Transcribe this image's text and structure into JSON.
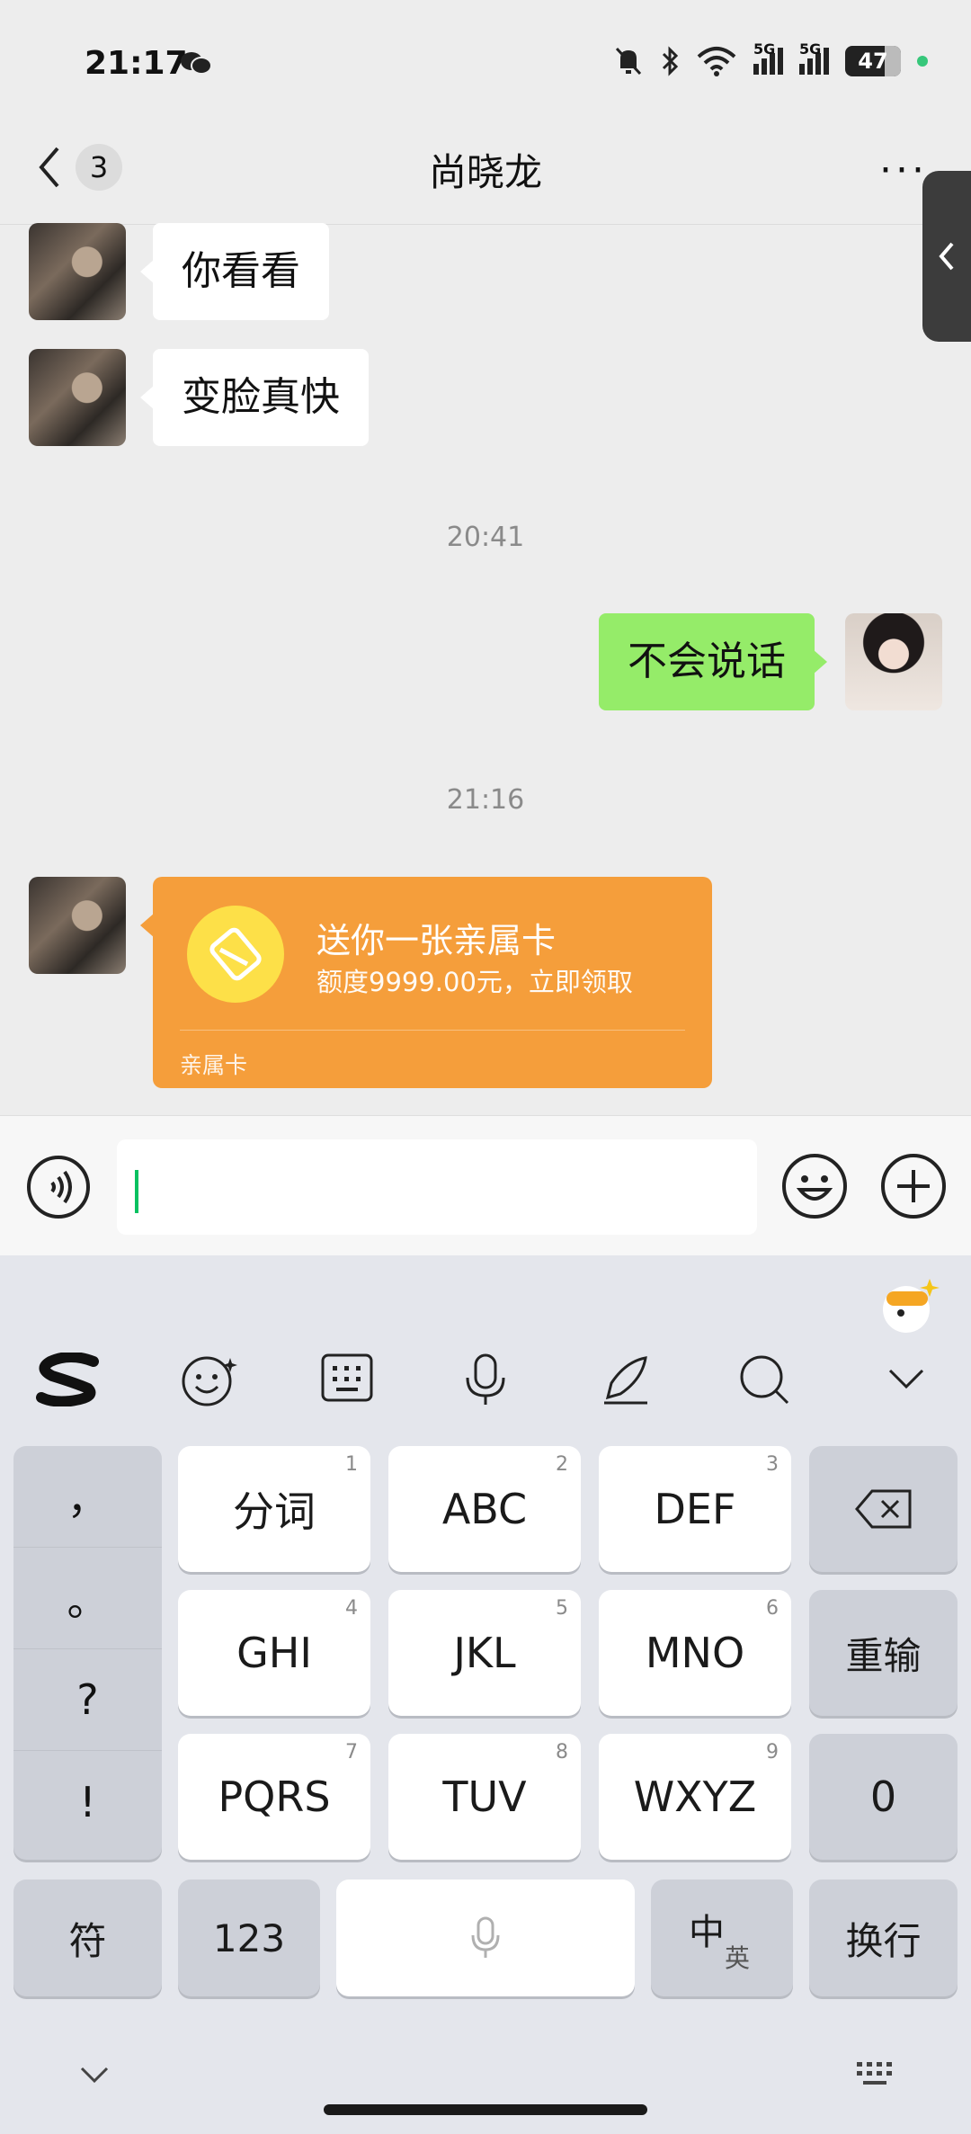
{
  "status_bar": {
    "time": "21:17",
    "battery": "47",
    "net1": "5G",
    "net2": "5G"
  },
  "nav": {
    "badge": "3",
    "title": "尚晓龙",
    "more": "···"
  },
  "messages": [
    {
      "from": "other",
      "text": "你看看"
    },
    {
      "from": "other",
      "text": "变脸真快"
    },
    {
      "type": "time",
      "text": "20:41"
    },
    {
      "from": "me",
      "text": "不会说话"
    },
    {
      "type": "time",
      "text": "21:16"
    }
  ],
  "card": {
    "title": "送你一张亲属卡",
    "subtitle": "额度9999.00元，立即领取",
    "footer": "亲属卡"
  },
  "keyboard": {
    "keys": [
      {
        "label": "分词",
        "num": "1"
      },
      {
        "label": "ABC",
        "num": "2"
      },
      {
        "label": "DEF",
        "num": "3"
      },
      {
        "label": "GHI",
        "num": "4"
      },
      {
        "label": "JKL",
        "num": "5"
      },
      {
        "label": "MNO",
        "num": "6"
      },
      {
        "label": "PQRS",
        "num": "7"
      },
      {
        "label": "TUV",
        "num": "8"
      },
      {
        "label": "WXYZ",
        "num": "9"
      }
    ],
    "punct": [
      "，",
      "。",
      "?",
      "!"
    ],
    "reinput": "重输",
    "zero": "0",
    "symbols": "符",
    "numbers": "123",
    "lang_main": "中",
    "lang_sub": "英",
    "enter": "换行"
  },
  "colors": {
    "accent": "#07c160",
    "bubble_me": "#95ec69",
    "card": "#f59e3b"
  }
}
